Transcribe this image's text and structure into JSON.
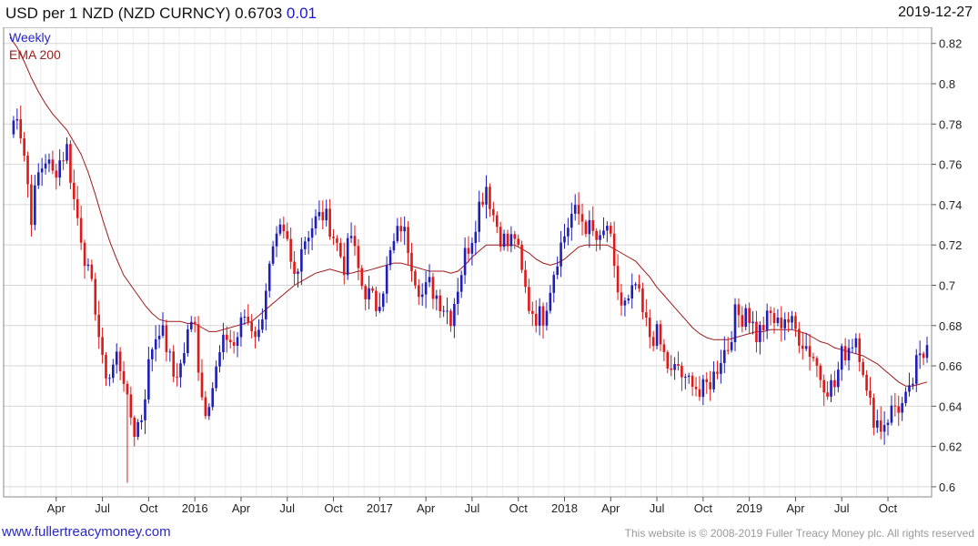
{
  "header": {
    "title": "USD per 1 NZD (NZD CURNCY) 0.6703",
    "change": "0.01",
    "date": "2019-12-27"
  },
  "legend": {
    "frequency": "Weekly",
    "ema": "EMA 200"
  },
  "footer": {
    "site": "www.fullertreacymoney.com",
    "copyright": "This website is © 2008-2019 Fuller Treacy Money plc. All rights reserved"
  },
  "colors": {
    "up": "#1f1fb8",
    "down": "#e01818",
    "ema": "#a01818",
    "grid": "#dddddd"
  },
  "chart_data": {
    "type": "candlestick",
    "frequency": "weekly",
    "ylim": [
      0.595,
      0.828
    ],
    "y_ticks": [
      0.6,
      0.62,
      0.64,
      0.66,
      0.68,
      0.7,
      0.72,
      0.74,
      0.76,
      0.78,
      0.8,
      0.82
    ],
    "y_tick_labels": [
      "0.6",
      "0.62",
      "0.64",
      "0.66",
      "0.68",
      "0.7",
      "0.72",
      "0.74",
      "0.76",
      "0.78",
      "0.8",
      "0.82"
    ],
    "x_labels": [
      "Apr",
      "Jul",
      "Oct",
      "2016",
      "Apr",
      "Jul",
      "Oct",
      "2017",
      "Apr",
      "Jul",
      "Oct",
      "2018",
      "Apr",
      "Jul",
      "Oct",
      "2019",
      "Apr",
      "Jul",
      "Oct"
    ],
    "x_label_weeks": [
      13,
      26,
      39,
      52,
      65,
      78,
      91,
      104,
      117,
      130,
      143,
      156,
      169,
      182,
      195,
      208,
      221,
      234,
      247
    ],
    "close_path": [
      [
        0,
        0.775
      ],
      [
        2,
        0.787
      ],
      [
        4,
        0.765
      ],
      [
        6,
        0.735
      ],
      [
        8,
        0.755
      ],
      [
        10,
        0.763
      ],
      [
        12,
        0.755
      ],
      [
        14,
        0.762
      ],
      [
        16,
        0.768
      ],
      [
        18,
        0.742
      ],
      [
        20,
        0.725
      ],
      [
        22,
        0.705
      ],
      [
        24,
        0.69
      ],
      [
        26,
        0.66
      ],
      [
        28,
        0.655
      ],
      [
        30,
        0.665
      ],
      [
        32,
        0.655
      ],
      [
        33,
        0.64
      ],
      [
        34,
        0.635
      ],
      [
        35,
        0.628
      ],
      [
        37,
        0.635
      ],
      [
        39,
        0.66
      ],
      [
        40,
        0.67
      ],
      [
        42,
        0.68
      ],
      [
        44,
        0.67
      ],
      [
        46,
        0.655
      ],
      [
        48,
        0.66
      ],
      [
        50,
        0.675
      ],
      [
        52,
        0.685
      ],
      [
        53,
        0.66
      ],
      [
        54,
        0.645
      ],
      [
        55,
        0.64
      ],
      [
        57,
        0.65
      ],
      [
        59,
        0.665
      ],
      [
        61,
        0.675
      ],
      [
        63,
        0.67
      ],
      [
        65,
        0.68
      ],
      [
        66,
        0.685
      ],
      [
        68,
        0.68
      ],
      [
        70,
        0.675
      ],
      [
        72,
        0.7
      ],
      [
        74,
        0.715
      ],
      [
        76,
        0.725
      ],
      [
        78,
        0.72
      ],
      [
        79,
        0.71
      ],
      [
        80,
        0.705
      ],
      [
        82,
        0.72
      ],
      [
        84,
        0.727
      ],
      [
        86,
        0.732
      ],
      [
        88,
        0.735
      ],
      [
        90,
        0.73
      ],
      [
        92,
        0.72
      ],
      [
        93,
        0.715
      ],
      [
        94,
        0.71
      ],
      [
        96,
        0.725
      ],
      [
        97,
        0.715
      ],
      [
        99,
        0.7
      ],
      [
        101,
        0.695
      ],
      [
        103,
        0.69
      ],
      [
        105,
        0.7
      ],
      [
        107,
        0.715
      ],
      [
        109,
        0.725
      ],
      [
        110,
        0.73
      ],
      [
        112,
        0.72
      ],
      [
        114,
        0.705
      ],
      [
        116,
        0.695
      ],
      [
        118,
        0.7
      ],
      [
        120,
        0.695
      ],
      [
        122,
        0.69
      ],
      [
        124,
        0.685
      ],
      [
        126,
        0.7
      ],
      [
        128,
        0.715
      ],
      [
        130,
        0.725
      ],
      [
        132,
        0.74
      ],
      [
        133,
        0.745
      ],
      [
        134,
        0.75
      ],
      [
        136,
        0.735
      ],
      [
        138,
        0.725
      ],
      [
        140,
        0.72
      ],
      [
        142,
        0.725
      ],
      [
        143,
        0.715
      ],
      [
        144,
        0.705
      ],
      [
        146,
        0.69
      ],
      [
        148,
        0.685
      ],
      [
        150,
        0.685
      ],
      [
        152,
        0.7
      ],
      [
        154,
        0.715
      ],
      [
        156,
        0.725
      ],
      [
        158,
        0.735
      ],
      [
        160,
        0.735
      ],
      [
        162,
        0.73
      ],
      [
        164,
        0.725
      ],
      [
        166,
        0.72
      ],
      [
        168,
        0.73
      ],
      [
        169,
        0.72
      ],
      [
        170,
        0.705
      ],
      [
        172,
        0.69
      ],
      [
        174,
        0.69
      ],
      [
        176,
        0.7
      ],
      [
        178,
        0.685
      ],
      [
        180,
        0.675
      ],
      [
        182,
        0.675
      ],
      [
        184,
        0.665
      ],
      [
        186,
        0.655
      ],
      [
        188,
        0.66
      ],
      [
        190,
        0.65
      ],
      [
        192,
        0.655
      ],
      [
        194,
        0.645
      ],
      [
        196,
        0.65
      ],
      [
        198,
        0.655
      ],
      [
        200,
        0.665
      ],
      [
        202,
        0.67
      ],
      [
        204,
        0.685
      ],
      [
        206,
        0.685
      ],
      [
        207,
        0.69
      ],
      [
        208,
        0.685
      ],
      [
        210,
        0.675
      ],
      [
        212,
        0.68
      ],
      [
        214,
        0.685
      ],
      [
        216,
        0.68
      ],
      [
        218,
        0.685
      ],
      [
        220,
        0.68
      ],
      [
        222,
        0.675
      ],
      [
        224,
        0.67
      ],
      [
        226,
        0.665
      ],
      [
        228,
        0.655
      ],
      [
        230,
        0.65
      ],
      [
        232,
        0.65
      ],
      [
        234,
        0.665
      ],
      [
        236,
        0.67
      ],
      [
        238,
        0.675
      ],
      [
        240,
        0.66
      ],
      [
        241,
        0.645
      ],
      [
        243,
        0.635
      ],
      [
        245,
        0.63
      ],
      [
        247,
        0.635
      ],
      [
        249,
        0.64
      ],
      [
        251,
        0.64
      ],
      [
        253,
        0.645
      ],
      [
        255,
        0.66
      ],
      [
        257,
        0.665
      ],
      [
        258,
        0.67
      ]
    ],
    "ema_200_path": [
      [
        0,
        0.823
      ],
      [
        2,
        0.818
      ],
      [
        4,
        0.811
      ],
      [
        6,
        0.803
      ],
      [
        8,
        0.796
      ],
      [
        10,
        0.79
      ],
      [
        12,
        0.785
      ],
      [
        14,
        0.781
      ],
      [
        16,
        0.777
      ],
      [
        18,
        0.771
      ],
      [
        20,
        0.765
      ],
      [
        22,
        0.756
      ],
      [
        24,
        0.745
      ],
      [
        26,
        0.733
      ],
      [
        28,
        0.722
      ],
      [
        30,
        0.713
      ],
      [
        32,
        0.705
      ],
      [
        34,
        0.7
      ],
      [
        36,
        0.695
      ],
      [
        38,
        0.69
      ],
      [
        40,
        0.686
      ],
      [
        42,
        0.683
      ],
      [
        44,
        0.682
      ],
      [
        46,
        0.682
      ],
      [
        48,
        0.682
      ],
      [
        50,
        0.681
      ],
      [
        52,
        0.681
      ],
      [
        54,
        0.679
      ],
      [
        56,
        0.677
      ],
      [
        58,
        0.677
      ],
      [
        60,
        0.678
      ],
      [
        62,
        0.679
      ],
      [
        64,
        0.68
      ],
      [
        66,
        0.681
      ],
      [
        68,
        0.682
      ],
      [
        70,
        0.685
      ],
      [
        72,
        0.688
      ],
      [
        74,
        0.691
      ],
      [
        76,
        0.694
      ],
      [
        78,
        0.697
      ],
      [
        80,
        0.7
      ],
      [
        82,
        0.702
      ],
      [
        84,
        0.704
      ],
      [
        86,
        0.706
      ],
      [
        88,
        0.707
      ],
      [
        90,
        0.708
      ],
      [
        92,
        0.707
      ],
      [
        94,
        0.706
      ],
      [
        96,
        0.706
      ],
      [
        98,
        0.707
      ],
      [
        100,
        0.707
      ],
      [
        102,
        0.708
      ],
      [
        104,
        0.709
      ],
      [
        106,
        0.71
      ],
      [
        108,
        0.711
      ],
      [
        110,
        0.711
      ],
      [
        112,
        0.71
      ],
      [
        114,
        0.709
      ],
      [
        116,
        0.708
      ],
      [
        118,
        0.707
      ],
      [
        120,
        0.707
      ],
      [
        122,
        0.707
      ],
      [
        124,
        0.706
      ],
      [
        126,
        0.707
      ],
      [
        128,
        0.71
      ],
      [
        130,
        0.714
      ],
      [
        132,
        0.717
      ],
      [
        134,
        0.72
      ],
      [
        136,
        0.72
      ],
      [
        138,
        0.72
      ],
      [
        140,
        0.72
      ],
      [
        142,
        0.72
      ],
      [
        144,
        0.718
      ],
      [
        146,
        0.716
      ],
      [
        148,
        0.713
      ],
      [
        150,
        0.711
      ],
      [
        152,
        0.71
      ],
      [
        154,
        0.711
      ],
      [
        156,
        0.713
      ],
      [
        158,
        0.716
      ],
      [
        160,
        0.719
      ],
      [
        162,
        0.72
      ],
      [
        164,
        0.72
      ],
      [
        166,
        0.72
      ],
      [
        168,
        0.72
      ],
      [
        170,
        0.718
      ],
      [
        172,
        0.716
      ],
      [
        174,
        0.714
      ],
      [
        176,
        0.712
      ],
      [
        178,
        0.708
      ],
      [
        180,
        0.704
      ],
      [
        182,
        0.699
      ],
      [
        184,
        0.695
      ],
      [
        186,
        0.691
      ],
      [
        188,
        0.687
      ],
      [
        190,
        0.683
      ],
      [
        192,
        0.679
      ],
      [
        194,
        0.676
      ],
      [
        196,
        0.674
      ],
      [
        198,
        0.673
      ],
      [
        200,
        0.673
      ],
      [
        202,
        0.673
      ],
      [
        204,
        0.674
      ],
      [
        206,
        0.675
      ],
      [
        208,
        0.676
      ],
      [
        210,
        0.677
      ],
      [
        212,
        0.677
      ],
      [
        214,
        0.678
      ],
      [
        216,
        0.678
      ],
      [
        218,
        0.678
      ],
      [
        220,
        0.678
      ],
      [
        222,
        0.677
      ],
      [
        224,
        0.676
      ],
      [
        226,
        0.674
      ],
      [
        228,
        0.672
      ],
      [
        230,
        0.671
      ],
      [
        232,
        0.669
      ],
      [
        234,
        0.668
      ],
      [
        236,
        0.667
      ],
      [
        238,
        0.666
      ],
      [
        240,
        0.665
      ],
      [
        242,
        0.663
      ],
      [
        244,
        0.661
      ],
      [
        246,
        0.658
      ],
      [
        248,
        0.655
      ],
      [
        250,
        0.652
      ],
      [
        252,
        0.65
      ],
      [
        254,
        0.65
      ],
      [
        256,
        0.651
      ],
      [
        258,
        0.652
      ]
    ],
    "extreme_low": {
      "week": 33,
      "value": 0.602
    },
    "last_close": 0.6703
  }
}
